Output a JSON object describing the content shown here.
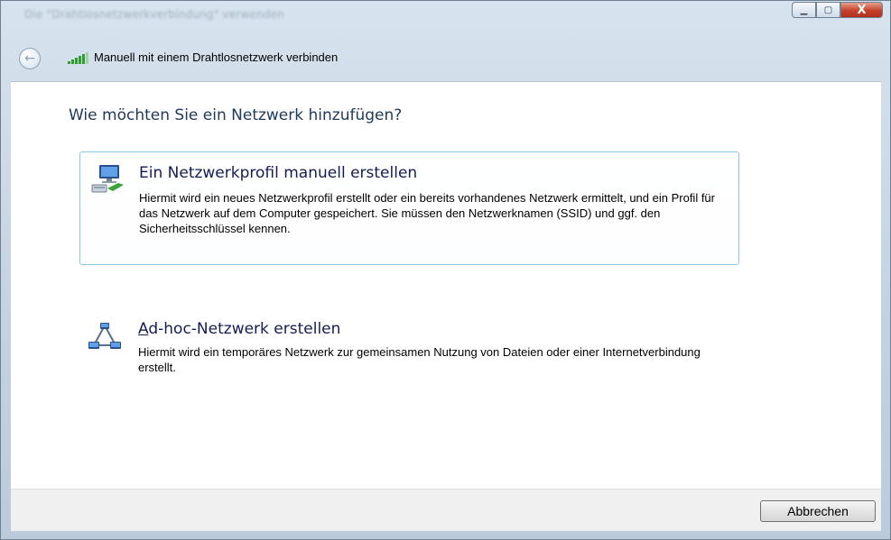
{
  "window": {
    "ghost_title": "Die \"Drahtlosnetzwerkverbindung\" verwenden",
    "minimize_symbol": "▁",
    "maximize_symbol": "▢",
    "close_symbol": "X"
  },
  "nav": {
    "title": "Manuell mit einem Drahtlosnetzwerk verbinden",
    "back_symbol": "←"
  },
  "main": {
    "heading": "Wie möchten Sie ein Netzwerk hinzufügen?",
    "options": [
      {
        "title": "Ein Netzwerkprofil manuell erstellen",
        "description": "Hiermit wird ein neues Netzwerkprofil erstellt oder ein bereits vorhandenes Netzwerk ermittelt, und ein Profil für das Netzwerk auf dem Computer gespeichert. Sie müssen den Netzwerknamen (SSID) und ggf. den Sicherheitsschlüssel kennen.",
        "icon": "network-computer-icon",
        "highlighted": true
      },
      {
        "title": "Ad-hoc-Netzwerk erstellen",
        "description": "Hiermit wird ein temporäres Netzwerk zur gemeinsamen Nutzung von Dateien oder einer Internetverbindung erstellt.",
        "icon": "adhoc-network-icon",
        "highlighted": false
      }
    ]
  },
  "footer": {
    "cancel_label": "Abbrechen"
  },
  "colors": {
    "heading": "#1e395b",
    "option_title": "#151c55",
    "card_border": "#8cc7e6",
    "close_button": "#c5412b"
  }
}
